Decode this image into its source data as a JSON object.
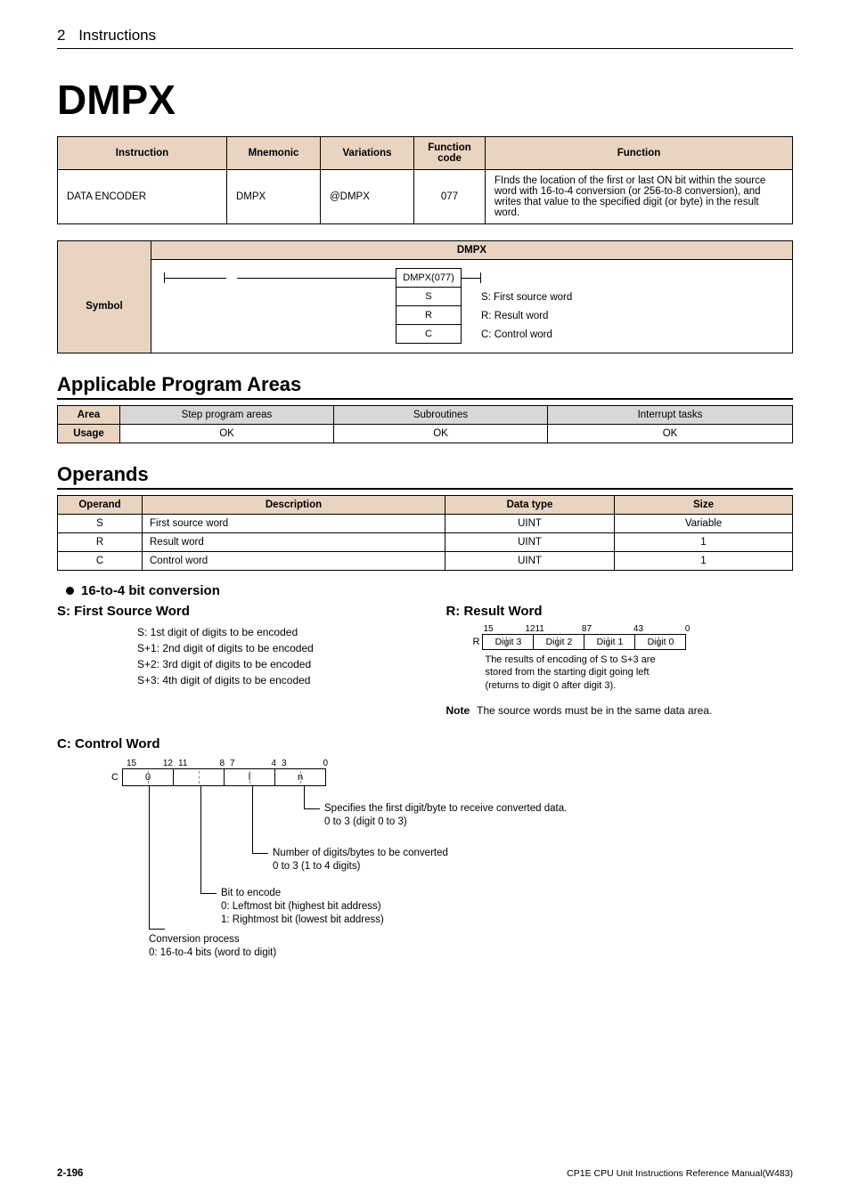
{
  "header": {
    "num": "2",
    "title": "Instructions"
  },
  "pageTitle": "DMPX",
  "instTable": {
    "headers": {
      "instruction": "Instruction",
      "mnemonic": "Mnemonic",
      "variations": "Variations",
      "fcode": "Function code",
      "function": "Function"
    },
    "row": {
      "instruction": "DATA ENCODER",
      "mnemonic": "DMPX",
      "variations": "@DMPX",
      "fcode": "077",
      "function": "FInds the location of the first or last ON bit within the source word with 16-to-4 conversion (or 256-to-8 conversion), and writes that value to the specified digit (or byte) in the result word."
    }
  },
  "symbolTable": {
    "colHeader": "DMPX",
    "rowHeader": "Symbol",
    "box": {
      "top": "DMPX(077)",
      "s": "S",
      "r": "R",
      "c": "C"
    },
    "labels": {
      "s": "S: First source word",
      "r": "R: Result word",
      "c": "C: Control word"
    }
  },
  "areasHeading": "Applicable Program Areas",
  "areaTable": {
    "h": {
      "area": "Area",
      "step": "Step program areas",
      "sub": "Subroutines",
      "int": "Interrupt tasks"
    },
    "r": {
      "usage": "Usage",
      "step": "OK",
      "sub": "OK",
      "int": "OK"
    }
  },
  "operandsHeading": "Operands",
  "operandsTable": {
    "h": {
      "op": "Operand",
      "desc": "Description",
      "dt": "Data type",
      "size": "Size"
    },
    "rows": [
      {
        "op": "S",
        "desc": "First source word",
        "dt": "UINT",
        "size": "Variable"
      },
      {
        "op": "R",
        "desc": "Result word",
        "dt": "UINT",
        "size": "1"
      },
      {
        "op": "C",
        "desc": "Control word",
        "dt": "UINT",
        "size": "1"
      }
    ]
  },
  "conv": {
    "bullet": "16-to-4 bit conversion",
    "sHead": "S: First Source Word",
    "sLines": [
      "S: 1st digit of digits to be encoded",
      "S+1: 2nd digit of digits to be encoded",
      "S+2: 3rd digit of digits to be encoded",
      "S+3: 4th digit of digits to be encoded"
    ],
    "rHead": "R: Result Word",
    "rBits": {
      "b15": "15",
      "b12": "12",
      "b11": "11",
      "b8": "8",
      "b7": "7",
      "b4": "4",
      "b3": "3",
      "b0": "0"
    },
    "rLabel": "R",
    "rCells": [
      "Digit 3",
      "Digit 2",
      "Digit 1",
      "Digit 0"
    ],
    "rText1": "The results of encoding of S to S+3 are",
    "rText2": "stored from the starting digit going left",
    "rText3": "(returns to digit 0 after digit 3).",
    "noteLabel": "Note",
    "noteText": "The source words must be in the same data area."
  },
  "cSection": {
    "head": "C: Control Word",
    "bits": {
      "b15": "15",
      "b12": "12",
      "b11": "11",
      "b8": "8",
      "b7": "7",
      "b4": "4",
      "b3": "3",
      "b0": "0"
    },
    "label": "C",
    "cells": {
      "d3": "0",
      "d2": "",
      "d1": "l",
      "d0": "n"
    },
    "n1": "Specifies the first digit/byte to receive converted data.",
    "n1b": "0 to 3 (digit 0 to 3)",
    "n2": "Number of digits/bytes to be converted",
    "n2b": "0 to 3 (1 to 4 digits)",
    "n3": "Bit to encode",
    "n3a": "0: Leftmost bit (highest bit address)",
    "n3b": "1: Rightmost bit (lowest bit address)",
    "n4": "Conversion process",
    "n4a": "0: 16-to-4 bits (word to digit)"
  },
  "footer": {
    "page": "2-196",
    "doc": "CP1E CPU Unit Instructions Reference Manual(W483)"
  }
}
